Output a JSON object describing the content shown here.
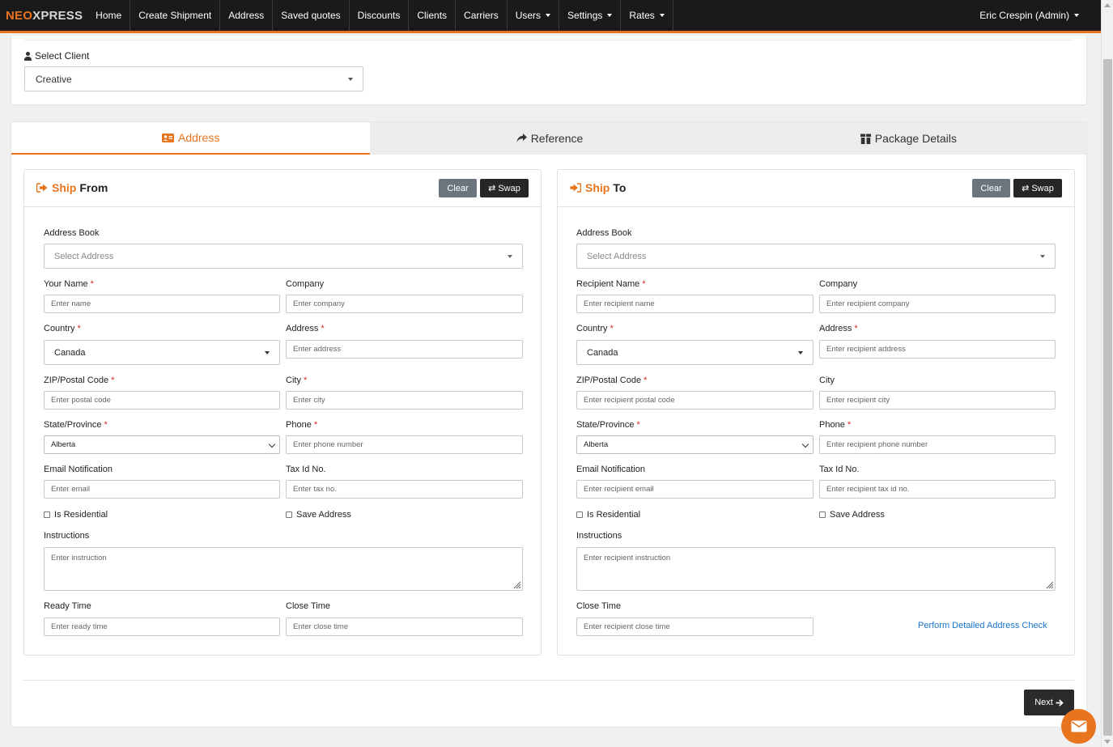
{
  "nav": {
    "brand_a": "NEO",
    "brand_b": "XPRESS",
    "items": [
      {
        "label": "Home"
      },
      {
        "label": "Create Shipment"
      },
      {
        "label": "Address"
      },
      {
        "label": "Saved quotes"
      },
      {
        "label": "Discounts"
      },
      {
        "label": "Clients"
      },
      {
        "label": "Carriers"
      },
      {
        "label": "Users"
      },
      {
        "label": "Settings"
      },
      {
        "label": "Rates"
      }
    ],
    "user": "Eric Crespin (Admin)"
  },
  "client": {
    "label": "Select Client",
    "value": "Creative"
  },
  "tabs": [
    {
      "label": "Address",
      "icon": "address-card-icon",
      "active": true
    },
    {
      "label": "Reference",
      "icon": "share-icon"
    },
    {
      "label": "Package Details",
      "icon": "box-icon"
    }
  ],
  "colors": {
    "accent": "#e8741e",
    "navbar": "#1a1a1a",
    "link": "#1a73c9",
    "required": "#d9251d"
  },
  "ship_from": {
    "title_a": "Ship",
    "title_b": "From",
    "clear": "Clear",
    "swap": "Swap",
    "address_book": {
      "label": "Address Book",
      "placeholder": "Select Address"
    },
    "name": {
      "label": "Your Name",
      "placeholder": "Enter name"
    },
    "company": {
      "label": "Company",
      "placeholder": "Enter company"
    },
    "country": {
      "label": "Country",
      "value": "Canada"
    },
    "address": {
      "label": "Address",
      "placeholder": "Enter address"
    },
    "zip": {
      "label": "ZIP/Postal Code",
      "placeholder": "Enter postal code"
    },
    "city": {
      "label": "City",
      "placeholder": "Enter city"
    },
    "state": {
      "label": "State/Province",
      "value": "Alberta"
    },
    "phone": {
      "label": "Phone",
      "placeholder": "Enter phone number"
    },
    "email": {
      "label": "Email Notification",
      "placeholder": "Enter email"
    },
    "tax": {
      "label": "Tax Id No.",
      "placeholder": "Enter tax no."
    },
    "residential": "Is Residential",
    "save_address": "Save Address",
    "instructions": {
      "label": "Instructions",
      "placeholder": "Enter instruction"
    },
    "ready_time": {
      "label": "Ready Time",
      "placeholder": "Enter ready time"
    },
    "close_time": {
      "label": "Close Time",
      "placeholder": "Enter close time"
    }
  },
  "ship_to": {
    "title_a": "Ship",
    "title_b": "To",
    "clear": "Clear",
    "swap": "Swap",
    "address_book": {
      "label": "Address Book",
      "placeholder": "Select Address"
    },
    "name": {
      "label": "Recipient Name",
      "placeholder": "Enter recipient name"
    },
    "company": {
      "label": "Company",
      "placeholder": "Enter recipient company"
    },
    "country": {
      "label": "Country",
      "value": "Canada"
    },
    "address": {
      "label": "Address",
      "placeholder": "Enter recipient address"
    },
    "zip": {
      "label": "ZIP/Postal Code",
      "placeholder": "Enter recipient postal code"
    },
    "city": {
      "label": "City",
      "placeholder": "Enter recipient city"
    },
    "state": {
      "label": "State/Province",
      "value": "Alberta"
    },
    "phone": {
      "label": "Phone",
      "placeholder": "Enter recipient phone number"
    },
    "email": {
      "label": "Email Notification",
      "placeholder": "Enter recipient email"
    },
    "tax": {
      "label": "Tax Id No.",
      "placeholder": "Enter recipient tax id no."
    },
    "residential": "Is Residential",
    "save_address": "Save Address",
    "instructions": {
      "label": "Instructions",
      "placeholder": "Enter recipient instruction"
    },
    "close_time": {
      "label": "Close Time",
      "placeholder": "Enter recipient close time"
    },
    "check_link": "Perform Detailed Address Check"
  },
  "footer": {
    "next": "Next"
  }
}
